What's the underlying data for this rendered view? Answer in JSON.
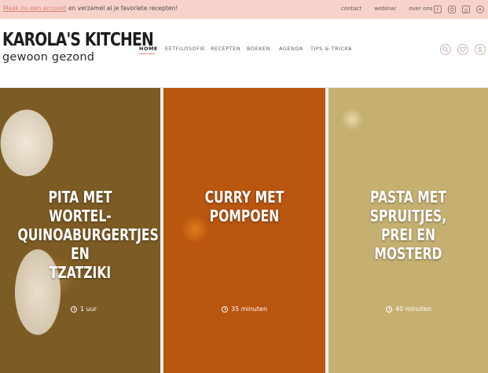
{
  "topbar": {
    "promo_link": "Maak nu een account",
    "promo_text": " en verzamel al je favoriete recepten!",
    "links": [
      "contact",
      "webinar",
      "over ons"
    ],
    "social_icons": [
      "facebook-icon",
      "instagram-icon",
      "pinterest-icon",
      "other-social-icon"
    ]
  },
  "header": {
    "logo_title": "KAROLA'S KITCHEN",
    "logo_subtitle": "gewoon gezond",
    "nav": [
      "HOME",
      "EETFILOSOFIE",
      "RECEPTEN",
      "BOEKEN",
      "AGENDA",
      "TIPS & TRICKS"
    ],
    "nav_dropdown_glyph": "⌄",
    "icons": [
      "search-icon",
      "heart-icon",
      "user-icon"
    ]
  },
  "cards": [
    {
      "title_line1": "PITA MET WORTEL-",
      "title_line2": "QUINOABURGERTJES EN",
      "title_line3": "TZATZIKI",
      "time": "1 uur"
    },
    {
      "title_line1": "CURRY MET POMPOEN",
      "time": "35 minuten"
    },
    {
      "title_line1": "PASTA MET SPRUITJES,",
      "title_line2": "PREI EN MOSTERD",
      "time": "40 minuten"
    }
  ],
  "colors": {
    "topbar_bg": "#f7d2cb",
    "accent": "#e58c7f"
  }
}
